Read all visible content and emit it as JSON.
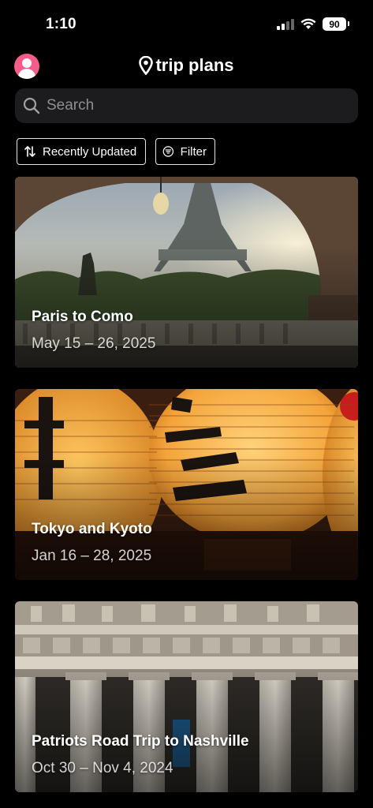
{
  "status_bar": {
    "time": "1:10",
    "battery": "90",
    "icons": [
      "signal-icon",
      "wifi-icon",
      "battery-icon"
    ]
  },
  "header": {
    "title": "trip plans",
    "title_icon": "map-pin-icon",
    "avatar_icon": "user-avatar-icon"
  },
  "search": {
    "placeholder": "Search",
    "value": ""
  },
  "chips": {
    "sort_label": "Recently Updated",
    "filter_label": "Filter"
  },
  "trips": [
    {
      "title": "Paris to Como",
      "dates": "May 15 – 26, 2025"
    },
    {
      "title": "Tokyo and Kyoto",
      "dates": "Jan 16 – 28, 2025"
    },
    {
      "title": "Patriots Road Trip to Nashville",
      "dates": "Oct 30 – Nov 4, 2024"
    }
  ],
  "colors": {
    "background": "#000000",
    "search_bg": "#1c1c1e",
    "avatar": "#f45c8a",
    "placeholder": "#8e8e93"
  }
}
